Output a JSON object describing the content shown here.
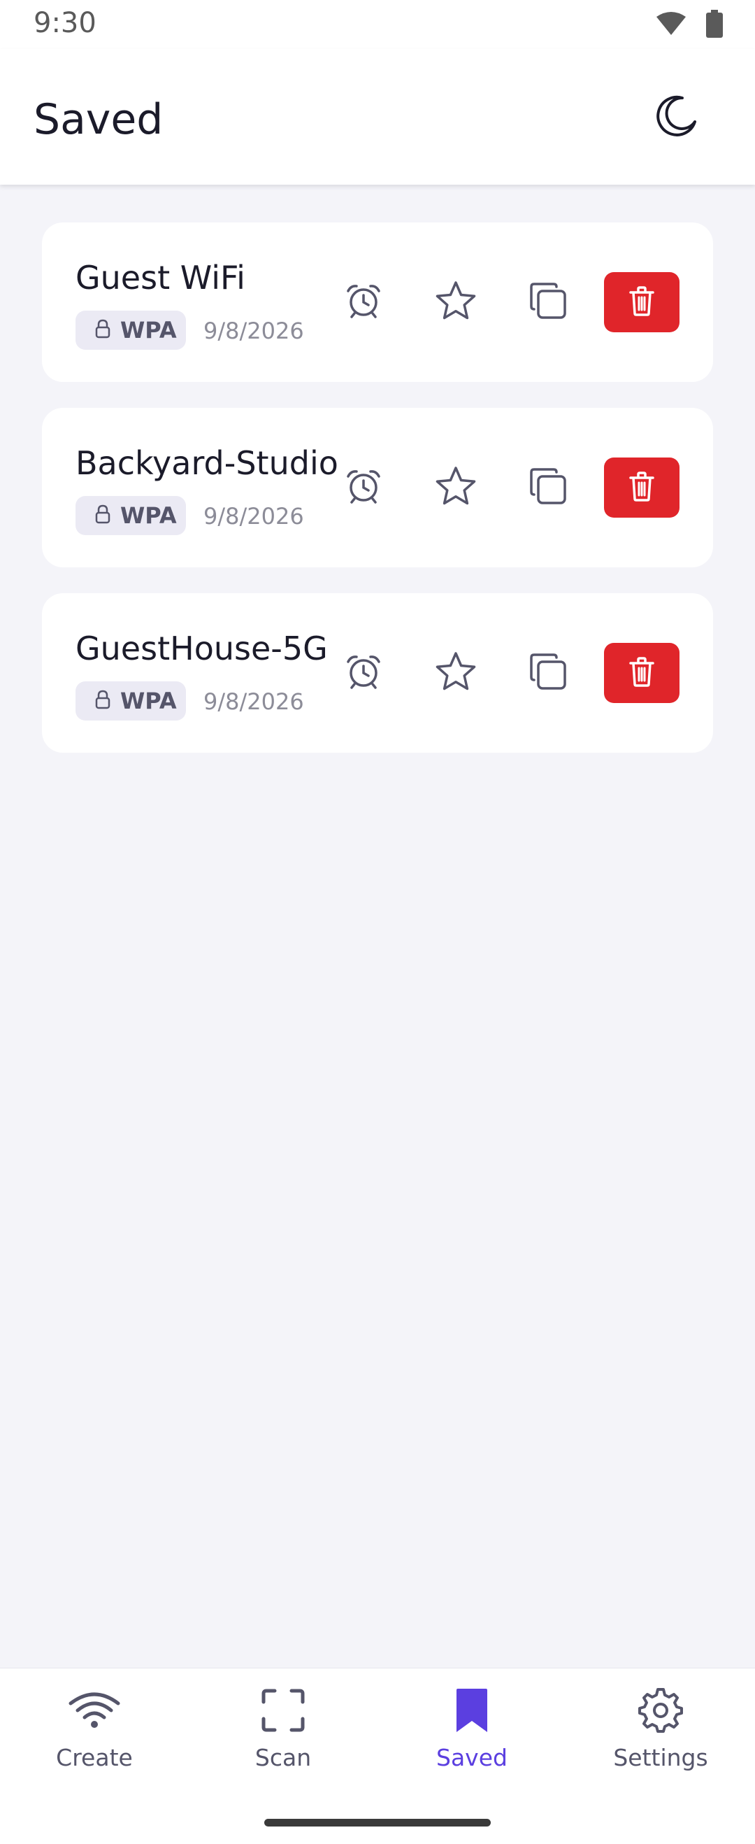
{
  "status_bar": {
    "time": "9:30",
    "icons": [
      "wifi-icon",
      "battery-icon"
    ]
  },
  "app_bar": {
    "title": "Saved",
    "theme_icon": "moon-icon"
  },
  "saved_networks": [
    {
      "name": "Guest WiFi",
      "security": "WPA",
      "date": "9/8/2026"
    },
    {
      "name": "Backyard-Studio",
      "security": "WPA",
      "date": "9/8/2026"
    },
    {
      "name": "GuestHouse-5G",
      "security": "WPA",
      "date": "9/8/2026"
    }
  ],
  "card_actions": [
    "alarm-icon",
    "star-icon",
    "copy-icon",
    "trash-icon"
  ],
  "bottom_nav": {
    "items": [
      {
        "label": "Create",
        "icon": "wifi-icon",
        "active": false
      },
      {
        "label": "Scan",
        "icon": "scan-frame-icon",
        "active": false
      },
      {
        "label": "Saved",
        "icon": "bookmark-icon",
        "active": true
      },
      {
        "label": "Settings",
        "icon": "gear-icon",
        "active": false
      }
    ]
  },
  "colors": {
    "accent": "#5b3fe0",
    "danger": "#e0252a",
    "background": "#f4f4f9",
    "surface": "#ffffff",
    "icon": "#55556a"
  }
}
